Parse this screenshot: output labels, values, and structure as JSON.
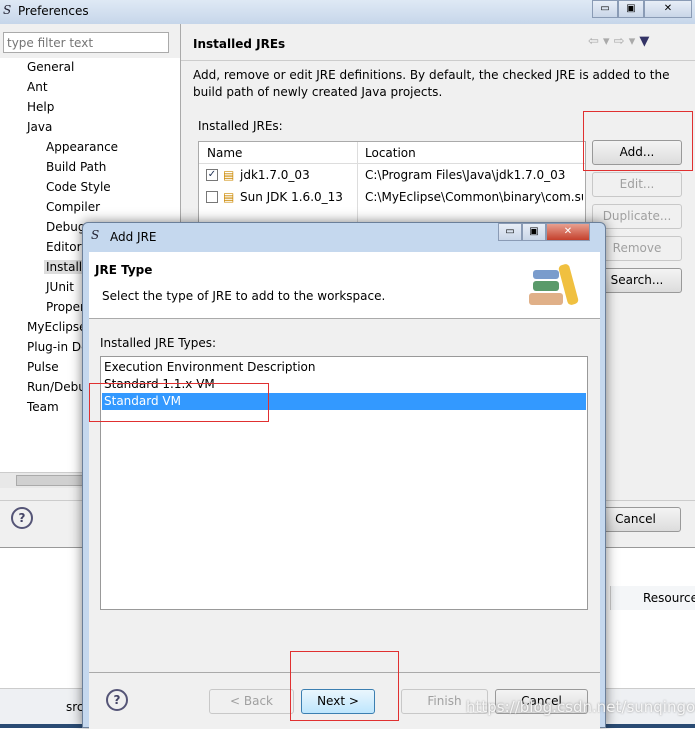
{
  "prefs": {
    "title": "Preferences",
    "filter_placeholder": "type filter text",
    "tree": [
      "General",
      "Ant",
      "Help",
      "Java",
      "Appearance",
      "Build Path",
      "Code Style",
      "Compiler",
      "Debug",
      "Editor",
      "Installed JREs",
      "JUnit",
      "Properties",
      "MyEclipse",
      "Plug-in Development",
      "Pulse",
      "Run/Debug",
      "Team"
    ],
    "page_title": "Installed JREs",
    "description": "Add, remove or edit JRE definitions. By default, the checked JRE is added to the build path of newly created Java projects.",
    "list_label": "Installed JREs:",
    "columns": [
      "Name",
      "Location"
    ],
    "rows": [
      {
        "name": "jdk1.7.0_03",
        "location": "C:\\Program Files\\Java\\jdk1.7.0_03",
        "checked": true
      },
      {
        "name": "Sun JDK 1.6.0_13",
        "location": "C:\\MyEclipse\\Common\\binary\\com.su",
        "checked": false
      }
    ],
    "buttons": {
      "add": "Add...",
      "edit": "Edit...",
      "duplicate": "Duplicate...",
      "remove": "Remove",
      "search": "Search...",
      "cancel": "Cancel"
    }
  },
  "background": {
    "column": "Resource",
    "status": "src"
  },
  "dialog": {
    "title": "Add JRE",
    "heading": "JRE Type",
    "subheading": "Select the type of JRE to add to the workspace.",
    "list_label": "Installed JRE Types:",
    "types": [
      "Execution Environment Description",
      "Standard 1.1.x VM",
      "Standard VM"
    ],
    "selected": "Standard VM",
    "buttons": {
      "back": "< Back",
      "next": "Next >",
      "finish": "Finish",
      "cancel": "Cancel"
    }
  },
  "watermark": "https://blog.csdn.net/sunqingok",
  "colors": {
    "selection": "#3399ff",
    "highlight": "#e03030"
  }
}
